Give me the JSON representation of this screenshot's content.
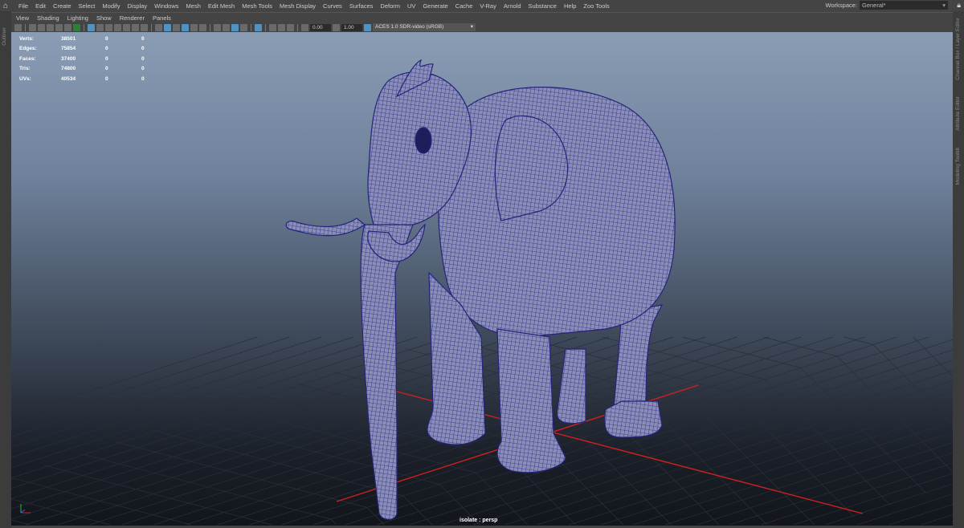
{
  "menubar": {
    "items": [
      "File",
      "Edit",
      "Create",
      "Select",
      "Modify",
      "Display",
      "Windows",
      "Mesh",
      "Edit Mesh",
      "Mesh Tools",
      "Mesh Display",
      "Curves",
      "Surfaces",
      "Deform",
      "UV",
      "Generate",
      "Cache",
      "V-Ray",
      "Arnold",
      "Substance",
      "Help",
      "Zoo Tools"
    ],
    "workspace_label": "Workspace:",
    "workspace_value": "General*"
  },
  "left_panel": {
    "label": "Outliner"
  },
  "right_panel": {
    "tabs": [
      "Channel Box / Layer Editor",
      "Attribute Editor",
      "Modeling Toolkit"
    ]
  },
  "panel_menu": {
    "items": [
      "View",
      "Shading",
      "Lighting",
      "Show",
      "Renderer",
      "Panels"
    ]
  },
  "toolbar": {
    "exposure": "0.00",
    "gamma": "1.00",
    "color_space": "ACES 1.0 SDR-video (sRGB)"
  },
  "hud": {
    "rows": [
      {
        "label": "Verts:",
        "v1": "38501",
        "v2": "0",
        "v3": "0"
      },
      {
        "label": "Edges:",
        "v1": "75854",
        "v2": "0",
        "v3": "0"
      },
      {
        "label": "Faces:",
        "v1": "37400",
        "v2": "0",
        "v3": "0"
      },
      {
        "label": "Tris:",
        "v1": "74800",
        "v2": "0",
        "v3": "0"
      },
      {
        "label": "UVs:",
        "v1": "40534",
        "v2": "0",
        "v3": "0"
      }
    ]
  },
  "viewport": {
    "camera_label": "isolate : persp",
    "mesh_color": "#2b2c8c",
    "grid_axis_color": "#d02020"
  }
}
